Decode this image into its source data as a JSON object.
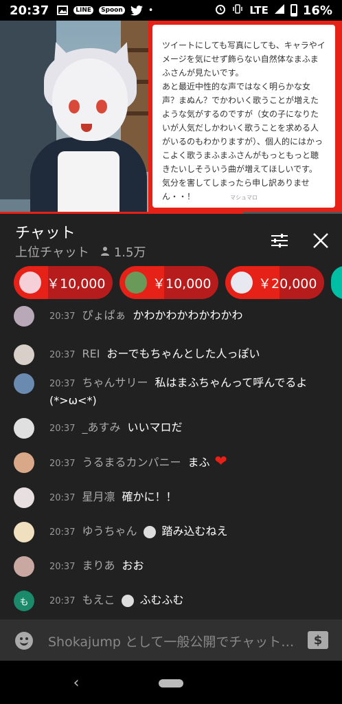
{
  "status_bar": {
    "time": "20:37",
    "icons_left": [
      "image-icon",
      "line-app-icon",
      "spoon-app-icon",
      "twitter-icon",
      "dot-icon"
    ],
    "line_label": "LINE",
    "spoon_label": "Spoon",
    "network": "LTE",
    "battery": "16%"
  },
  "video": {
    "overlay_card_text": "ツイートにしても写真にしても、キャラやイメージを気にせず飾らない自然体なまふまふさんが見たいです。\nあと最近中性的な声ではなく明らかな女声？まぬん？でかわいく歌うことが増えたような気がするのですが（女の子になりたいが人気だしかわいく歌うことを求める人がいるのもわかりますが）、個人的にはかっこよく歌うまふまふさんがもっともっと聴きたいしそういう曲が増えてほしいです。\n気分を害してしまったら申し訳ありません・・！",
    "overlay_card_footer": "マシュマロ",
    "progress": 0.7
  },
  "chat_header": {
    "title": "チャット",
    "mode": "上位チャット",
    "viewers": "1.5万"
  },
  "tickers": [
    {
      "amount": "￥10,000",
      "avatar_color": "#f5d0d8",
      "progress": 0.35
    },
    {
      "amount": "￥10,000",
      "avatar_color": "#6a9a5a",
      "progress": 0.45
    },
    {
      "amount": "￥20,000",
      "avatar_color": "#e8e8f0",
      "progress": 0.55
    }
  ],
  "messages": [
    {
      "time": "20:37",
      "author": "ぴょぱぁ",
      "text": "かわかわかわかわかわ",
      "avatar_color": "#b8a8b8",
      "badge": false,
      "heart": false
    },
    {
      "time": "20:37",
      "author": "REI",
      "text": "おーでもちゃんとした人っぽい",
      "avatar_color": "#d8d0c8",
      "badge": false,
      "heart": false
    },
    {
      "time": "20:37",
      "author": "ちゃんサリー",
      "text": "私はまふちゃんって呼んでるよ(*>ω<*)",
      "avatar_color": "#6a8ab0",
      "badge": false,
      "heart": false
    },
    {
      "time": "20:37",
      "author": "_あすみ",
      "text": "いいマロだ",
      "avatar_color": "#e0e0e0",
      "badge": false,
      "heart": false
    },
    {
      "time": "20:37",
      "author": "うるまるカンパニー",
      "text": "まふ",
      "avatar_color": "#d8a888",
      "badge": false,
      "heart": true
    },
    {
      "time": "20:37",
      "author": "星月凛",
      "text": "確かに！！",
      "avatar_color": "#e8e0e0",
      "badge": false,
      "heart": false
    },
    {
      "time": "20:37",
      "author": "ゆうちゃん",
      "text": "踏み込むねえ",
      "avatar_color": "#f0e0c0",
      "badge": true,
      "heart": false
    },
    {
      "time": "20:37",
      "author": "まりあ",
      "text": "おお",
      "avatar_color": "#c8a8a0",
      "badge": false,
      "heart": false
    },
    {
      "time": "20:37",
      "author": "もえこ",
      "text": "ふむふむ",
      "avatar_color": "#1a8a6a",
      "avatar_letter": "も",
      "badge": true,
      "heart": false
    }
  ],
  "input": {
    "placeholder": "Shokajump として一般公開でチャット…"
  },
  "colors": {
    "accent": "#e62117",
    "panel": "#212121",
    "input": "#303030"
  }
}
